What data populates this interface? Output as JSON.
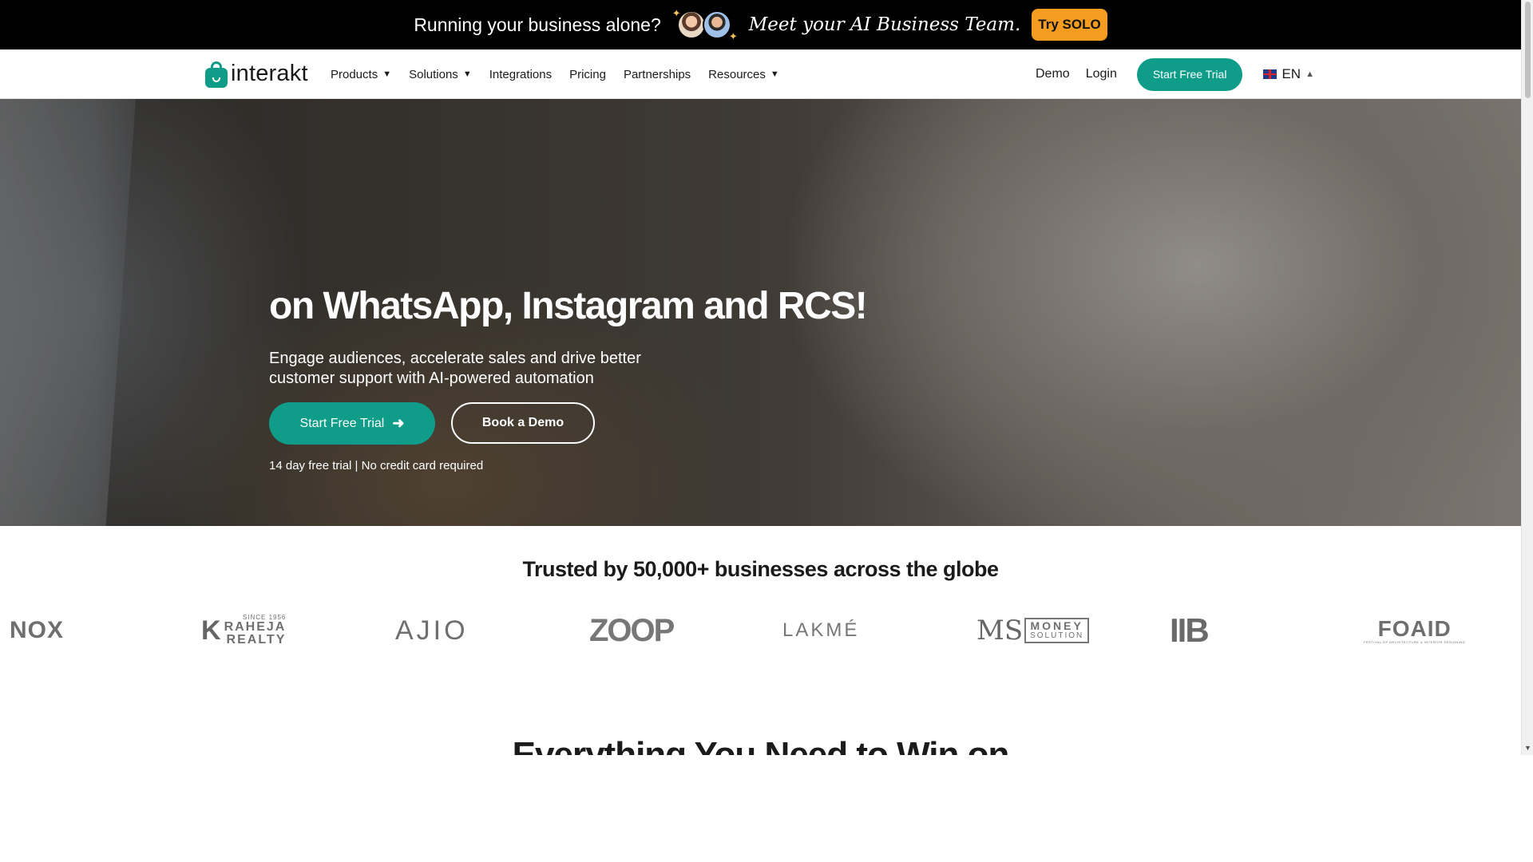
{
  "promo": {
    "text": "Running your business alone?",
    "tagline": "Meet your AI Business Team.",
    "button": "Try SOLO"
  },
  "nav": {
    "logo": "interakt",
    "links": [
      {
        "label": "Products",
        "dropdown": true
      },
      {
        "label": "Solutions",
        "dropdown": true
      },
      {
        "label": "Integrations",
        "dropdown": false
      },
      {
        "label": "Pricing",
        "dropdown": false
      },
      {
        "label": "Partnerships",
        "dropdown": false
      },
      {
        "label": "Resources",
        "dropdown": true
      }
    ],
    "demo": "Demo",
    "login": "Login",
    "trial": "Start Free Trial",
    "lang": "EN"
  },
  "hero": {
    "title": "on WhatsApp, Instagram and RCS!",
    "subtitle": "Engage audiences, accelerate sales and drive better customer support with AI-powered automation",
    "primary_cta": "Start Free Trial",
    "secondary_cta": "Book a Demo",
    "note": "14 day free trial | No credit card required"
  },
  "trusted": {
    "title": "Trusted by 50,000+ businesses across the globe",
    "logos": {
      "nox": "NOX",
      "raheja_since": "SINCE 1956",
      "raheja_1": "RAHEJA",
      "raheja_2": "REALTY",
      "ajio": "AJIO",
      "zoop": "ZOOP",
      "lakme": "LAKMÉ",
      "money_1": "MONEY",
      "money_2": "SOLUTION",
      "iib": "IIB",
      "foaid": "FOAID",
      "foaid_sub": "FESTIVAL OF ARCHITECTURE & INTERIOR DESIGNING"
    }
  },
  "next_section": {
    "title": "Everything You Need to Win on"
  },
  "colors": {
    "brand": "#0f9d8a",
    "promo_button": "#f39c1f",
    "promo_bg": "#000000"
  }
}
